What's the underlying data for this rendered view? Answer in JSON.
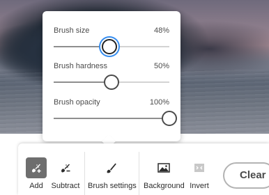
{
  "popover": {
    "sliders": [
      {
        "label": "Brush size",
        "value_text": "48%",
        "value": 0.48,
        "focused": true
      },
      {
        "label": "Brush hardness",
        "value_text": "50%",
        "value": 0.5,
        "focused": false
      },
      {
        "label": "Brush opacity",
        "value_text": "100%",
        "value": 1.0,
        "focused": false
      }
    ]
  },
  "toolbar": {
    "tools": [
      {
        "label": "Add",
        "icon": "brush-add-icon",
        "active": true
      },
      {
        "label": "Subtract",
        "icon": "brush-subtract-icon",
        "active": false
      },
      {
        "label": "Brush settings",
        "icon": "brush-icon",
        "active": false
      },
      {
        "label": "Background",
        "icon": "image-icon",
        "active": false
      },
      {
        "label": "Invert",
        "icon": "invert-icon",
        "active": false,
        "disabled": true
      }
    ],
    "clear_label": "Clear"
  },
  "colors": {
    "focus_ring": "#378ef0",
    "active_tool_bg": "#6e6e6e"
  }
}
